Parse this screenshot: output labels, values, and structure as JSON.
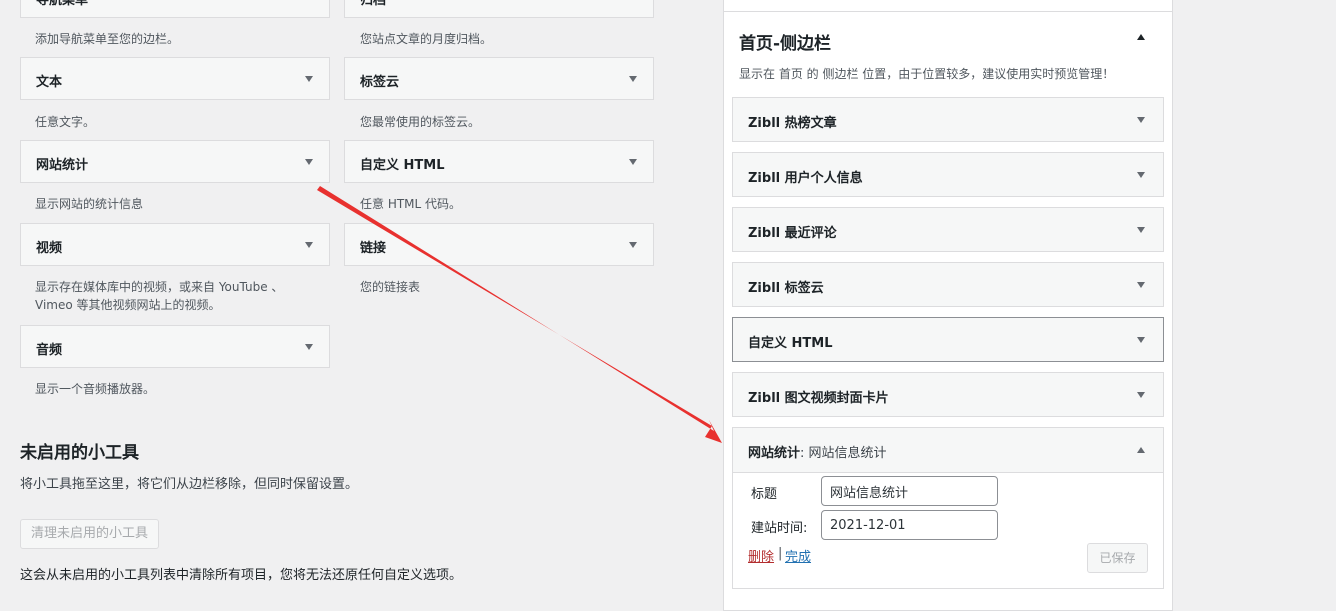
{
  "available_widgets": [
    {
      "title": "导航菜单",
      "desc": "添加导航菜单至您的边栏。"
    },
    {
      "title": "归档",
      "desc": "您站点文章的月度归档。"
    },
    {
      "title": "文本",
      "desc": "任意文字。"
    },
    {
      "title": "标签云",
      "desc": "您最常使用的标签云。"
    },
    {
      "title": "网站统计",
      "desc": "显示网站的统计信息"
    },
    {
      "title": "自定义 HTML",
      "desc": "任意 HTML 代码。"
    },
    {
      "title": "视频",
      "desc1": "显示存在媒体库中的视频，或来自 YouTube 、",
      "desc2": "Vimeo 等其他视频网站上的视频。"
    },
    {
      "title": "链接",
      "desc": "您的链接表"
    },
    {
      "title": "音频",
      "desc": "显示一个音频播放器。"
    }
  ],
  "inactive": {
    "title": "未启用的小工具",
    "desc": "将小工具拖至这里，将它们从边栏移除，但同时保留设置。",
    "clear_button": "清理未启用的小工具",
    "footer_desc": "这会从未启用的小工具列表中清除所有项目，您将无法还原任何自定义选项。"
  },
  "sidebar": {
    "title": "首页-侧边栏",
    "desc": "显示在 首页 的 侧边栏 位置，由于位置较多，建议使用实时预览管理！",
    "widgets": [
      "Zibll 热榜文章",
      "Zibll 用户个人信息",
      "Zibll 最近评论",
      "Zibll 标签云",
      "自定义 HTML",
      "Zibll 图文视频封面卡片"
    ],
    "open_widget": {
      "name": "网站统计",
      "subtitle": ": 网站信息统计",
      "title_label": "标题",
      "title_value": "网站信息统计",
      "date_label": "建站时间:",
      "date_value": "2021-12-01",
      "delete_link": "删除",
      "separator": "|",
      "done_link": "完成",
      "saved_button": "已保存"
    }
  },
  "colors": {
    "annotation_arrow": "#e8312f",
    "delete": "#b32d2e",
    "link": "#2271b1"
  }
}
